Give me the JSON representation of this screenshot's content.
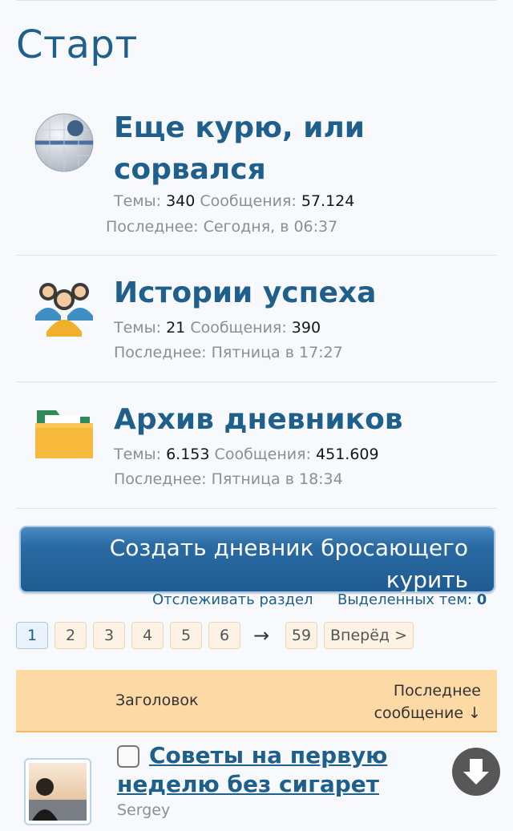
{
  "page": {
    "title": "Старт"
  },
  "forums": [
    {
      "icon": "radar-icon",
      "title": "Еще курю, или сорвался",
      "threads_label": "Темы:",
      "threads": "340",
      "messages_label": "Сообщения:",
      "messages": "57.124",
      "last": "Последнее: Сегодня, в 06:37"
    },
    {
      "icon": "people-group-icon",
      "title": "Истории успеха",
      "threads_label": "Темы:",
      "threads": "21",
      "messages_label": "Сообщения:",
      "messages": "390",
      "last": "Последнее: Пятница в 17:27"
    },
    {
      "icon": "folder-icon",
      "title": "Архив дневников",
      "threads_label": "Темы:",
      "threads": "6.153",
      "messages_label": "Сообщения:",
      "messages": "451.609",
      "last": "Последнее: Пятница в 18:34"
    }
  ],
  "actions": {
    "create_label": "Создать дневник бросающего курить",
    "watch_label": "Отслеживать раздел",
    "selected_label": "Выделенных тем:",
    "selected_count": "0"
  },
  "pagination": {
    "pages": [
      "1",
      "2",
      "3",
      "4",
      "5",
      "6"
    ],
    "current": "1",
    "arrow": "→",
    "last_page": "59",
    "next_label": "Вперёд >"
  },
  "table": {
    "col_title": "Заголовок",
    "col_last": "Последнее сообщение ↓"
  },
  "threads": [
    {
      "title": "Советы на первую неделю без сигарет",
      "author": "Sergey"
    }
  ],
  "colors": {
    "accent": "#1f5f8b",
    "button": "#1e5b90",
    "table_header": "#fcd9a5",
    "pager_bg": "#fdf3e4"
  }
}
